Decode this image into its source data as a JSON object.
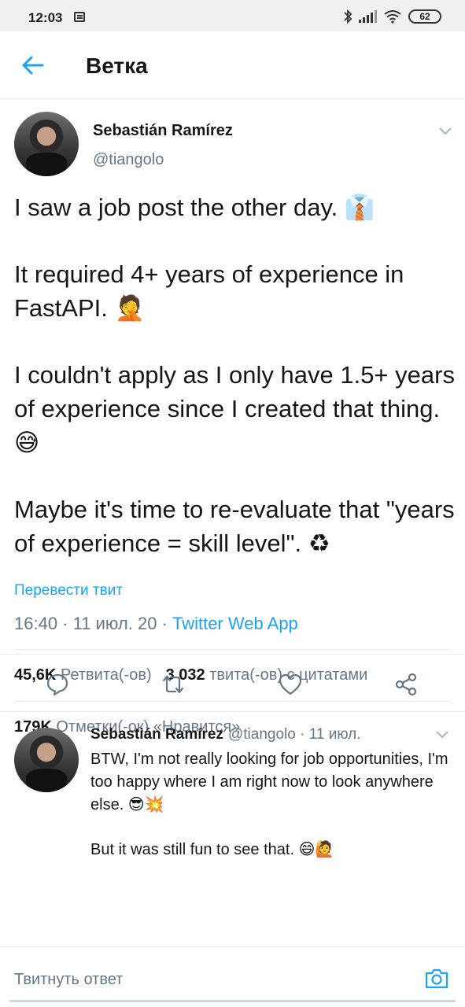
{
  "status_bar": {
    "time": "12:03",
    "battery": "62",
    "icons": [
      "notification-icon",
      "bluetooth-icon",
      "signal-icon",
      "wifi-icon",
      "battery-icon"
    ]
  },
  "header": {
    "title": "Ветка",
    "back_icon": "arrow-left-icon"
  },
  "tweet": {
    "author_name": "Sebastián Ramírez",
    "author_handle": "@tiangolo",
    "paragraphs": [
      "I saw a job post the other day. 👔",
      "It required 4+ years of experience in FastAPI. 🤦",
      "I couldn't apply as I only have 1.5+ years of experience since I created that thing. 😅",
      "Maybe it's time to re-evaluate that \"years of experience = skill level\". ♻"
    ],
    "translate_label": "Перевести твит",
    "time": "16:40",
    "date": "11 июл. 20",
    "client": "Twitter Web App",
    "retweets_count": "45,6K",
    "retweets_label": "Ретвита(-ов)",
    "quotes_count": "3 032",
    "quotes_label": "твита(-ов) с цитатами",
    "likes_count": "179K",
    "likes_label": "Отметки(-ок) «Нравится»",
    "actions": [
      "reply-icon",
      "retweet-icon",
      "like-icon",
      "share-icon"
    ]
  },
  "reply": {
    "author_name": "Sebastián Ramírez",
    "handle_and_date": "@tiangolo · 11 июл.",
    "paragraphs": [
      "BTW, I'm not really looking for job opportunities, I'm too happy where I am right now to look anywhere else. 😎💥",
      "But it was still fun to see that. 😄🙋"
    ]
  },
  "composer": {
    "placeholder": "Твитнуть ответ",
    "camera_icon": "camera-icon"
  },
  "colors": {
    "accent": "#1da1f2",
    "secondary_text": "#657786",
    "divider": "#e6ecf0"
  }
}
